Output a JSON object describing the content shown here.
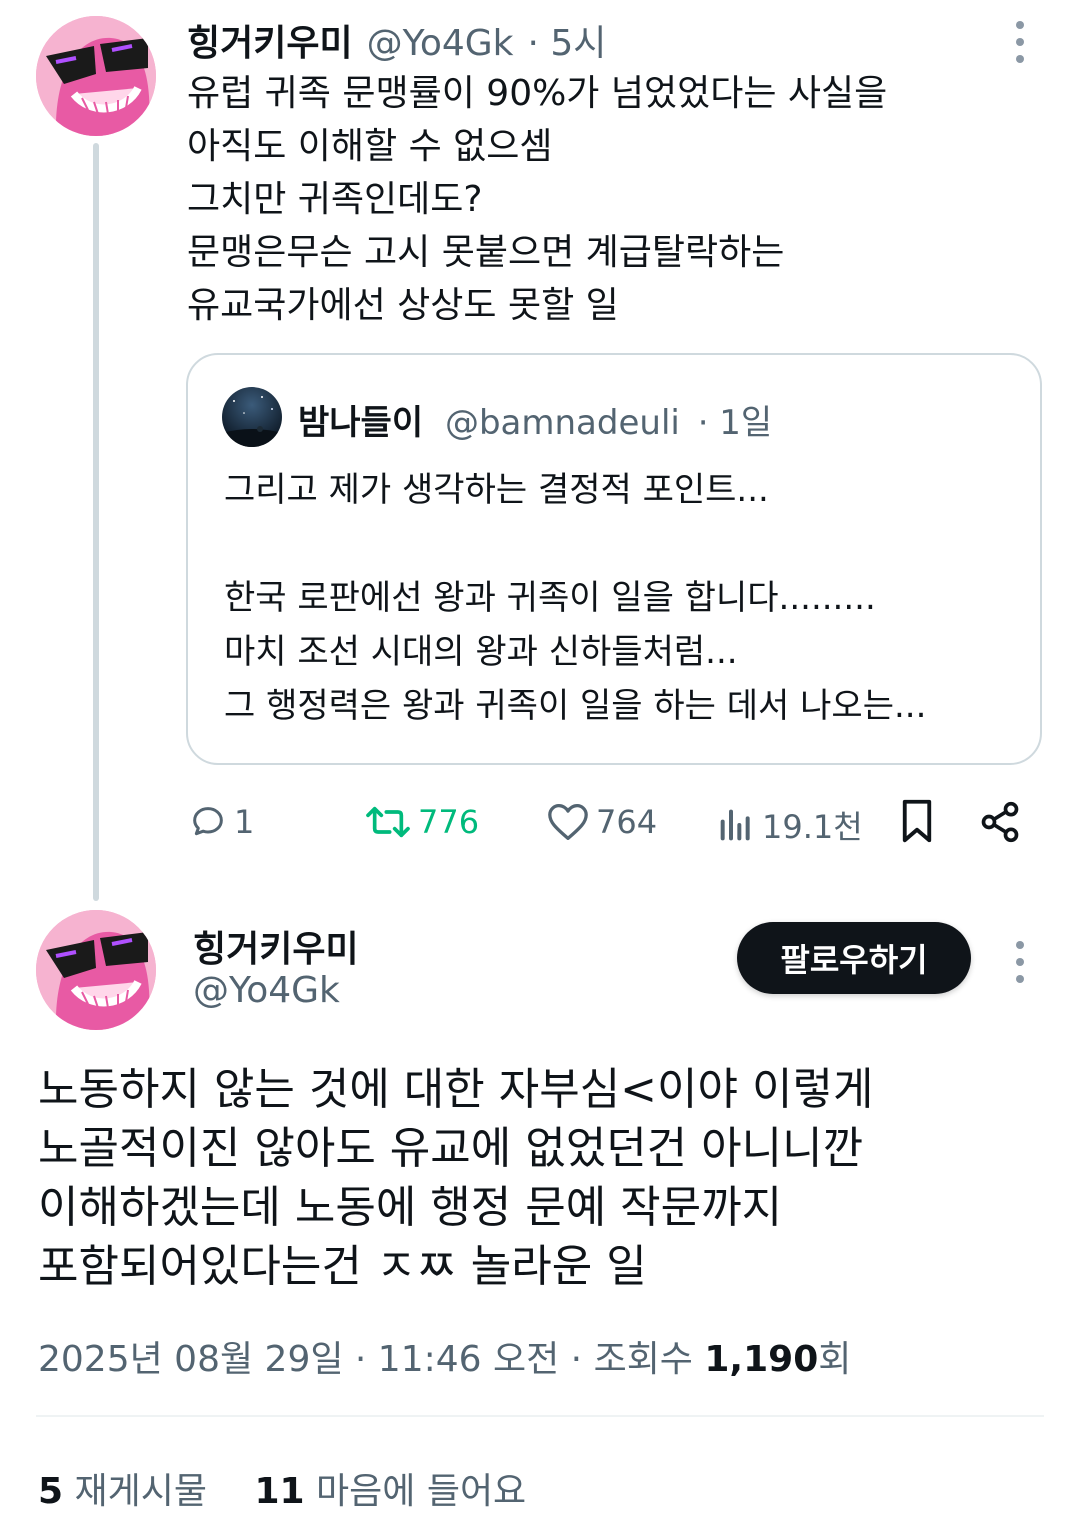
{
  "quoted_tweet_post": {
    "author_name": "힝거키우미",
    "handle": "@Yo4Gk",
    "time": "· 5시",
    "text_lines": [
      "유럽 귀족 문맹률이 90%가 넘었었다는 사실을",
      "아직도 이해할 수 없으셈",
      "그치만 귀족인데도?",
      "문맹은무슨 고시 못붙으면 계급탈락하는",
      "유교국가에선 상상도 못할 일"
    ],
    "quote": {
      "author_name": "밤나들이",
      "handle": "@bamnadeuli",
      "time": "· 1일",
      "text_lines": [
        "그리고 제가 생각하는 결정적 포인트...",
        "",
        "한국 로판에선 왕과 귀족이 일을 합니다.........",
        "마치 조선 시대의 왕과 신하들처럼...",
        "그 행정력은 왕과 귀족이 일을 하는 데서 나오는..."
      ]
    },
    "actions": {
      "replies": "1",
      "retweets": "776",
      "likes": "764",
      "views": "19.1천"
    }
  },
  "main_post": {
    "author_name": "힝거키우미",
    "handle": "@Yo4Gk",
    "follow_label": "팔로우하기",
    "text_lines": [
      "노동하지 않는 것에 대한 자부심<이야 이렇게",
      "노골적이진 않아도 유교에 없었던건 아니니깐",
      "이해하겠는데 노동에 행정 문예 작문까지",
      "포함되어있다는건 ㅈㅉ 놀라운 일"
    ],
    "date": "2025년 08월 29일 · 11:46 오전 · 조회수 ",
    "views_count": "1,190",
    "views_suffix": "회",
    "reposts_count": "5",
    "reposts_label": "재게시물",
    "likes_count": "11",
    "likes_label": "마음에 들어요"
  },
  "colors": {
    "text": "#0f1419",
    "muted": "#536471",
    "retweet_green": "#00ba7c",
    "border": "#cfd9de",
    "avatar_pink": "#f2a9c9"
  },
  "icons": [
    "more-icon",
    "reply-icon",
    "retweet-icon",
    "like-icon",
    "views-icon",
    "bookmark-icon",
    "share-icon"
  ]
}
